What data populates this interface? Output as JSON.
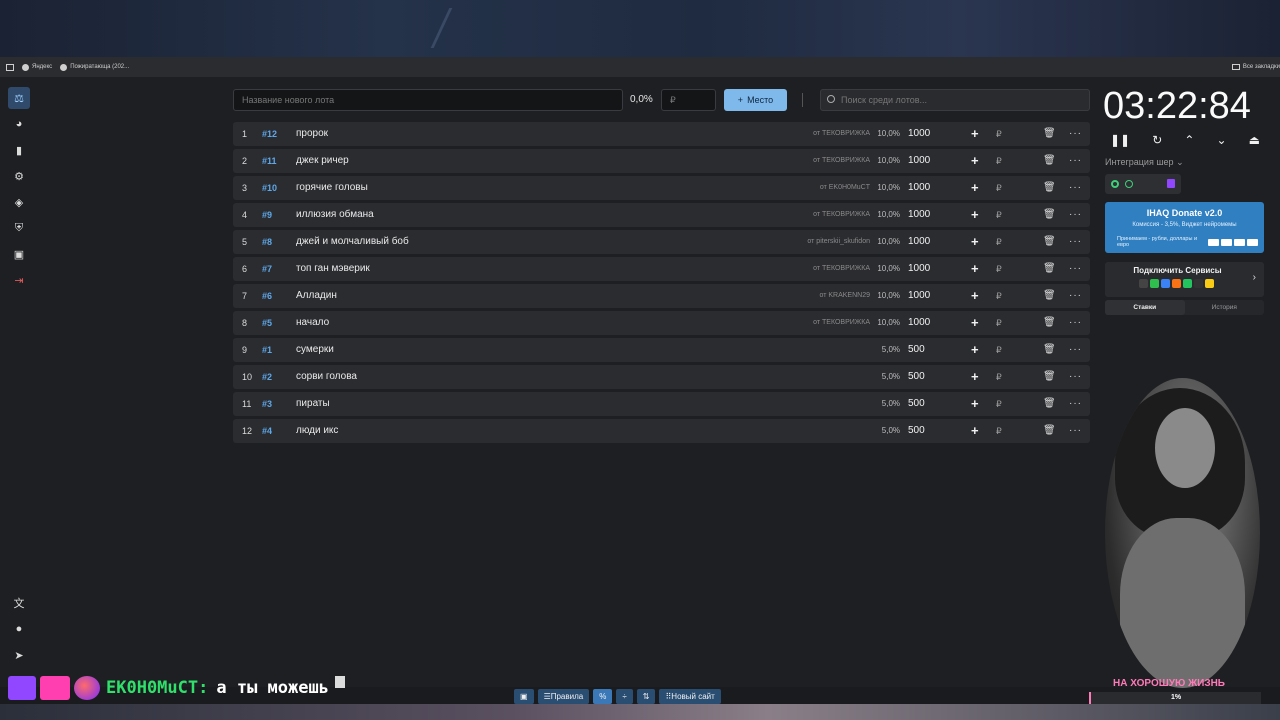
{
  "bookmarks": {
    "items": [
      "Яндекс",
      "Пожиратающа (202..."
    ],
    "right": "Все закладки"
  },
  "toolbar": {
    "lot_placeholder": "Название нового лота",
    "percent": "0,0%",
    "rub_placeholder": "₽",
    "place_label": "Место",
    "search_placeholder": "Поиск среди лотов..."
  },
  "lots": [
    {
      "idx": "1",
      "id": "#12",
      "name": "пророк",
      "from": "от ТЕКОВРИЖКА",
      "pct": "10,0%",
      "amount": "1000"
    },
    {
      "idx": "2",
      "id": "#11",
      "name": "джек ричер",
      "from": "от ТЕКОВРИЖКА",
      "pct": "10,0%",
      "amount": "1000"
    },
    {
      "idx": "3",
      "id": "#10",
      "name": "горячие головы",
      "from": "от EK0H0MuCT",
      "pct": "10,0%",
      "amount": "1000"
    },
    {
      "idx": "4",
      "id": "#9",
      "name": "иллюзия обмана",
      "from": "от ТЕКОВРИЖКА",
      "pct": "10,0%",
      "amount": "1000"
    },
    {
      "idx": "5",
      "id": "#8",
      "name": "джей и молчаливый боб",
      "from": "от piterskii_skufidon",
      "pct": "10,0%",
      "amount": "1000"
    },
    {
      "idx": "6",
      "id": "#7",
      "name": "топ ган мэверик",
      "from": "от ТЕКОВРИЖКА",
      "pct": "10,0%",
      "amount": "1000"
    },
    {
      "idx": "7",
      "id": "#6",
      "name": "Алладин",
      "from": "от KRAKENN29",
      "pct": "10,0%",
      "amount": "1000"
    },
    {
      "idx": "8",
      "id": "#5",
      "name": "начало",
      "from": "от ТЕКОВРИЖКА",
      "pct": "10,0%",
      "amount": "1000"
    },
    {
      "idx": "9",
      "id": "#1",
      "name": "сумерки",
      "from": "",
      "pct": "5,0%",
      "amount": "500"
    },
    {
      "idx": "10",
      "id": "#2",
      "name": "сорви голова",
      "from": "",
      "pct": "5,0%",
      "amount": "500"
    },
    {
      "idx": "11",
      "id": "#3",
      "name": "пираты",
      "from": "",
      "pct": "5,0%",
      "amount": "500"
    },
    {
      "idx": "12",
      "id": "#4",
      "name": "люди икс",
      "from": "",
      "pct": "5,0%",
      "amount": "500"
    }
  ],
  "row_icons": {
    "plus": "+",
    "rub": "₽",
    "trash": "🗑",
    "more": "···"
  },
  "timer": "03:22:84",
  "integration": "Интеграция шер",
  "ihaq": {
    "title": "IHAQ Donate v2.0",
    "subtitle": "Комиссия - 3,5%, Виджет нейромемы",
    "note": "Принимаем - рубли, доллары и евро"
  },
  "services": {
    "title": "Подключить Сервисы"
  },
  "tabs": {
    "bets": "Ставки",
    "history": "История"
  },
  "cam_caption": "НА ХОРОШУЮ ЖИЗНЬ",
  "progress": "1%",
  "chat": {
    "user": "EK0H0MuCT:",
    "message": "а ты можешь"
  },
  "bottom": {
    "rules": "Правила",
    "new_site": "Новый сайт"
  },
  "colors": {
    "accent": "#7fb8ea",
    "id_blue": "#5ea8ea",
    "chat_user": "#2fe06b",
    "pink": "#ff7ab8"
  }
}
